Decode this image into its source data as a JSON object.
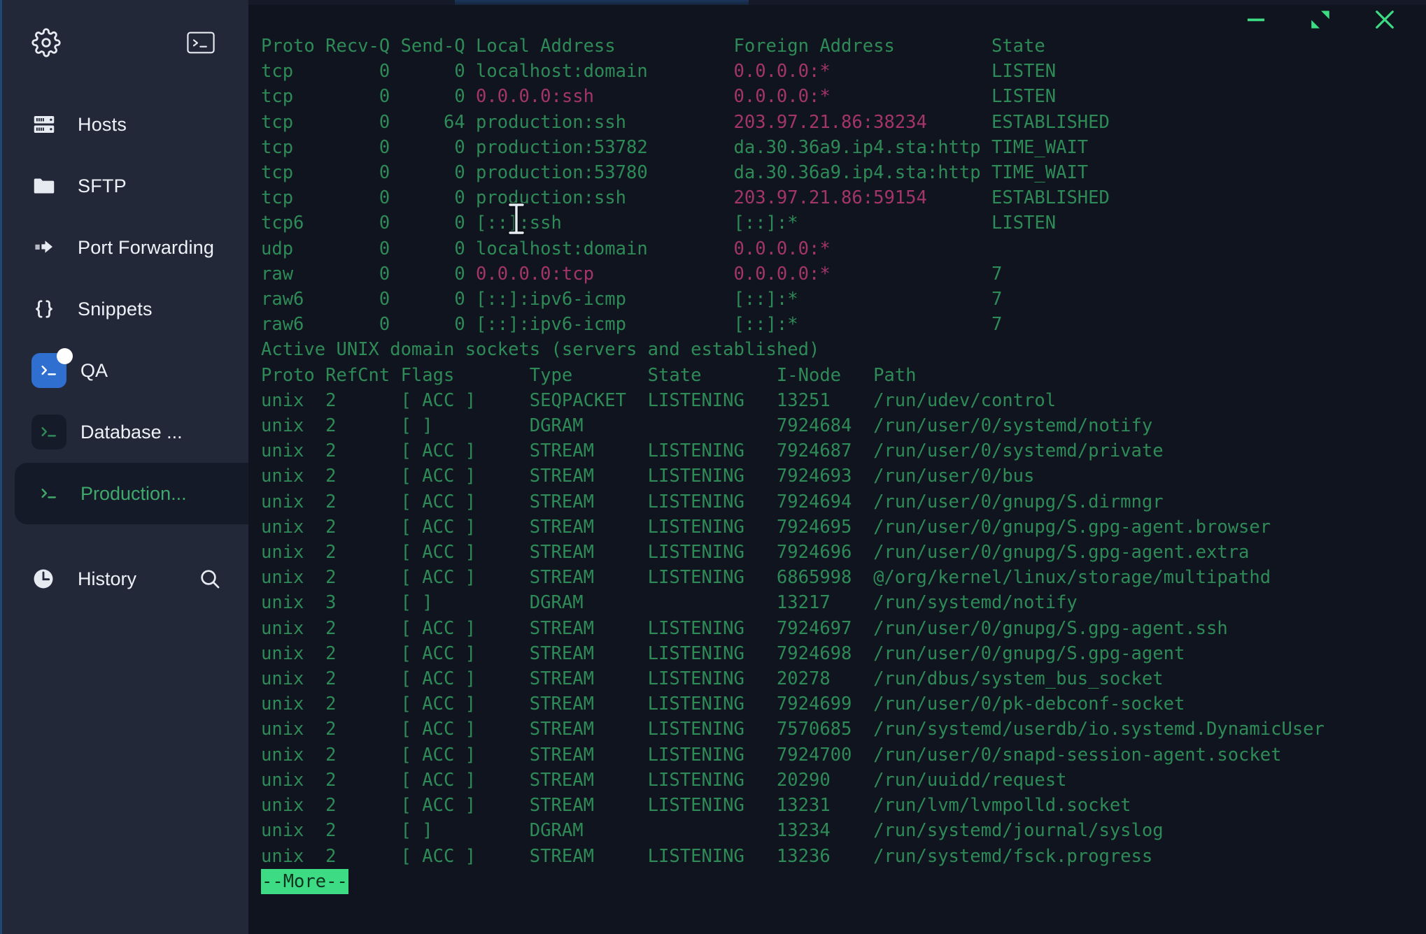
{
  "window": {
    "controls": [
      {
        "name": "minimize",
        "glyph": "minimize-icon"
      },
      {
        "name": "maximize",
        "glyph": "maximize-icon"
      },
      {
        "name": "close",
        "glyph": "close-icon"
      }
    ]
  },
  "sidebar": {
    "top_actions": [
      {
        "id": "settings",
        "icon": "gear-icon"
      },
      {
        "id": "new-terminal",
        "icon": "terminal-icon"
      }
    ],
    "nav": [
      {
        "id": "hosts",
        "label": "Hosts",
        "icon": "server-icon"
      },
      {
        "id": "sftp",
        "label": "SFTP",
        "icon": "folder-icon"
      },
      {
        "id": "port-forwarding",
        "label": "Port Forwarding",
        "icon": "port-forward-icon"
      },
      {
        "id": "snippets",
        "label": "Snippets",
        "icon": "braces-icon"
      }
    ],
    "sessions": [
      {
        "id": "qa",
        "label": "QA",
        "icon": "terminal-icon",
        "style": "blue",
        "badge": true,
        "selected": false
      },
      {
        "id": "database",
        "label": "Database ...",
        "icon": "terminal-icon",
        "style": "dark",
        "badge": false,
        "selected": false
      },
      {
        "id": "production",
        "label": "Production...",
        "icon": "terminal-icon",
        "style": "flat",
        "badge": false,
        "selected": true
      }
    ],
    "history": {
      "label": "History",
      "icon": "clock-icon",
      "search_icon": "search-icon"
    }
  },
  "colors": {
    "terminal_green": "#2e8b57",
    "terminal_pink": "#a3356b",
    "accent_blue": "#2f6fd0",
    "more_highlight": "#3ddc84",
    "sidebar_bg": "#232838",
    "terminal_bg": "#10141e"
  },
  "terminal": {
    "inet_header": {
      "proto": "Proto",
      "recvq": "Recv-Q",
      "sendq": "Send-Q",
      "local": "Local Address",
      "foreign": "Foreign Address",
      "state": "State"
    },
    "inet_rows": [
      {
        "proto": "tcp",
        "recvq": "0",
        "sendq": "0",
        "local": "localhost:domain",
        "local_pink": false,
        "foreign": "0.0.0.0:*",
        "foreign_pink": true,
        "state": "LISTEN"
      },
      {
        "proto": "tcp",
        "recvq": "0",
        "sendq": "0",
        "local": "0.0.0.0:ssh",
        "local_pink": true,
        "foreign": "0.0.0.0:*",
        "foreign_pink": true,
        "state": "LISTEN"
      },
      {
        "proto": "tcp",
        "recvq": "0",
        "sendq": "64",
        "local": "production:ssh",
        "local_pink": false,
        "foreign": "203.97.21.86:38234",
        "foreign_pink": true,
        "state": "ESTABLISHED"
      },
      {
        "proto": "tcp",
        "recvq": "0",
        "sendq": "0",
        "local": "production:53782",
        "local_pink": false,
        "foreign": "da.30.36a9.ip4.sta:http",
        "foreign_pink": false,
        "state": "TIME_WAIT"
      },
      {
        "proto": "tcp",
        "recvq": "0",
        "sendq": "0",
        "local": "production:53780",
        "local_pink": false,
        "foreign": "da.30.36a9.ip4.sta:http",
        "foreign_pink": false,
        "state": "TIME_WAIT"
      },
      {
        "proto": "tcp",
        "recvq": "0",
        "sendq": "0",
        "local": "production:ssh",
        "local_pink": false,
        "foreign": "203.97.21.86:59154",
        "foreign_pink": true,
        "state": "ESTABLISHED"
      },
      {
        "proto": "tcp6",
        "recvq": "0",
        "sendq": "0",
        "local": "[::]:ssh",
        "local_pink": false,
        "foreign": "[::]:*",
        "foreign_pink": false,
        "state": "LISTEN"
      },
      {
        "proto": "udp",
        "recvq": "0",
        "sendq": "0",
        "local": "localhost:domain",
        "local_pink": false,
        "foreign": "0.0.0.0:*",
        "foreign_pink": true,
        "state": ""
      },
      {
        "proto": "raw",
        "recvq": "0",
        "sendq": "0",
        "local": "0.0.0.0:tcp",
        "local_pink": true,
        "foreign": "0.0.0.0:*",
        "foreign_pink": true,
        "state": "7"
      },
      {
        "proto": "raw6",
        "recvq": "0",
        "sendq": "0",
        "local": "[::]:ipv6-icmp",
        "local_pink": false,
        "foreign": "[::]:*",
        "foreign_pink": false,
        "state": "7"
      },
      {
        "proto": "raw6",
        "recvq": "0",
        "sendq": "0",
        "local": "[::]:ipv6-icmp",
        "local_pink": false,
        "foreign": "[::]:*",
        "foreign_pink": false,
        "state": "7"
      }
    ],
    "unix_title": "Active UNIX domain sockets (servers and established)",
    "unix_header": {
      "proto": "Proto",
      "refcnt": "RefCnt",
      "flags": "Flags",
      "type": "Type",
      "state": "State",
      "inode": "I-Node",
      "path": "Path"
    },
    "unix_rows": [
      {
        "proto": "unix",
        "refcnt": "2",
        "flags": "[ ACC ]",
        "type": "SEQPACKET",
        "state": "LISTENING",
        "inode": "13251",
        "path": "/run/udev/control"
      },
      {
        "proto": "unix",
        "refcnt": "2",
        "flags": "[ ]",
        "type": "DGRAM",
        "state": "",
        "inode": "7924684",
        "path": "/run/user/0/systemd/notify"
      },
      {
        "proto": "unix",
        "refcnt": "2",
        "flags": "[ ACC ]",
        "type": "STREAM",
        "state": "LISTENING",
        "inode": "7924687",
        "path": "/run/user/0/systemd/private"
      },
      {
        "proto": "unix",
        "refcnt": "2",
        "flags": "[ ACC ]",
        "type": "STREAM",
        "state": "LISTENING",
        "inode": "7924693",
        "path": "/run/user/0/bus"
      },
      {
        "proto": "unix",
        "refcnt": "2",
        "flags": "[ ACC ]",
        "type": "STREAM",
        "state": "LISTENING",
        "inode": "7924694",
        "path": "/run/user/0/gnupg/S.dirmngr"
      },
      {
        "proto": "unix",
        "refcnt": "2",
        "flags": "[ ACC ]",
        "type": "STREAM",
        "state": "LISTENING",
        "inode": "7924695",
        "path": "/run/user/0/gnupg/S.gpg-agent.browser"
      },
      {
        "proto": "unix",
        "refcnt": "2",
        "flags": "[ ACC ]",
        "type": "STREAM",
        "state": "LISTENING",
        "inode": "7924696",
        "path": "/run/user/0/gnupg/S.gpg-agent.extra"
      },
      {
        "proto": "unix",
        "refcnt": "2",
        "flags": "[ ACC ]",
        "type": "STREAM",
        "state": "LISTENING",
        "inode": "6865998",
        "path": "@/org/kernel/linux/storage/multipathd"
      },
      {
        "proto": "unix",
        "refcnt": "3",
        "flags": "[ ]",
        "type": "DGRAM",
        "state": "",
        "inode": "13217",
        "path": "/run/systemd/notify"
      },
      {
        "proto": "unix",
        "refcnt": "2",
        "flags": "[ ACC ]",
        "type": "STREAM",
        "state": "LISTENING",
        "inode": "7924697",
        "path": "/run/user/0/gnupg/S.gpg-agent.ssh"
      },
      {
        "proto": "unix",
        "refcnt": "2",
        "flags": "[ ACC ]",
        "type": "STREAM",
        "state": "LISTENING",
        "inode": "7924698",
        "path": "/run/user/0/gnupg/S.gpg-agent"
      },
      {
        "proto": "unix",
        "refcnt": "2",
        "flags": "[ ACC ]",
        "type": "STREAM",
        "state": "LISTENING",
        "inode": "20278",
        "path": "/run/dbus/system_bus_socket"
      },
      {
        "proto": "unix",
        "refcnt": "2",
        "flags": "[ ACC ]",
        "type": "STREAM",
        "state": "LISTENING",
        "inode": "7924699",
        "path": "/run/user/0/pk-debconf-socket"
      },
      {
        "proto": "unix",
        "refcnt": "2",
        "flags": "[ ACC ]",
        "type": "STREAM",
        "state": "LISTENING",
        "inode": "7570685",
        "path": "/run/systemd/userdb/io.systemd.DynamicUser"
      },
      {
        "proto": "unix",
        "refcnt": "2",
        "flags": "[ ACC ]",
        "type": "STREAM",
        "state": "LISTENING",
        "inode": "7924700",
        "path": "/run/user/0/snapd-session-agent.socket"
      },
      {
        "proto": "unix",
        "refcnt": "2",
        "flags": "[ ACC ]",
        "type": "STREAM",
        "state": "LISTENING",
        "inode": "20290",
        "path": "/run/uuidd/request"
      },
      {
        "proto": "unix",
        "refcnt": "2",
        "flags": "[ ACC ]",
        "type": "STREAM",
        "state": "LISTENING",
        "inode": "13231",
        "path": "/run/lvm/lvmpolld.socket"
      },
      {
        "proto": "unix",
        "refcnt": "2",
        "flags": "[ ]",
        "type": "DGRAM",
        "state": "",
        "inode": "13234",
        "path": "/run/systemd/journal/syslog"
      },
      {
        "proto": "unix",
        "refcnt": "2",
        "flags": "[ ACC ]",
        "type": "STREAM",
        "state": "LISTENING",
        "inode": "13236",
        "path": "/run/systemd/fsck.progress"
      }
    ],
    "pager_prompt": "--More--"
  }
}
